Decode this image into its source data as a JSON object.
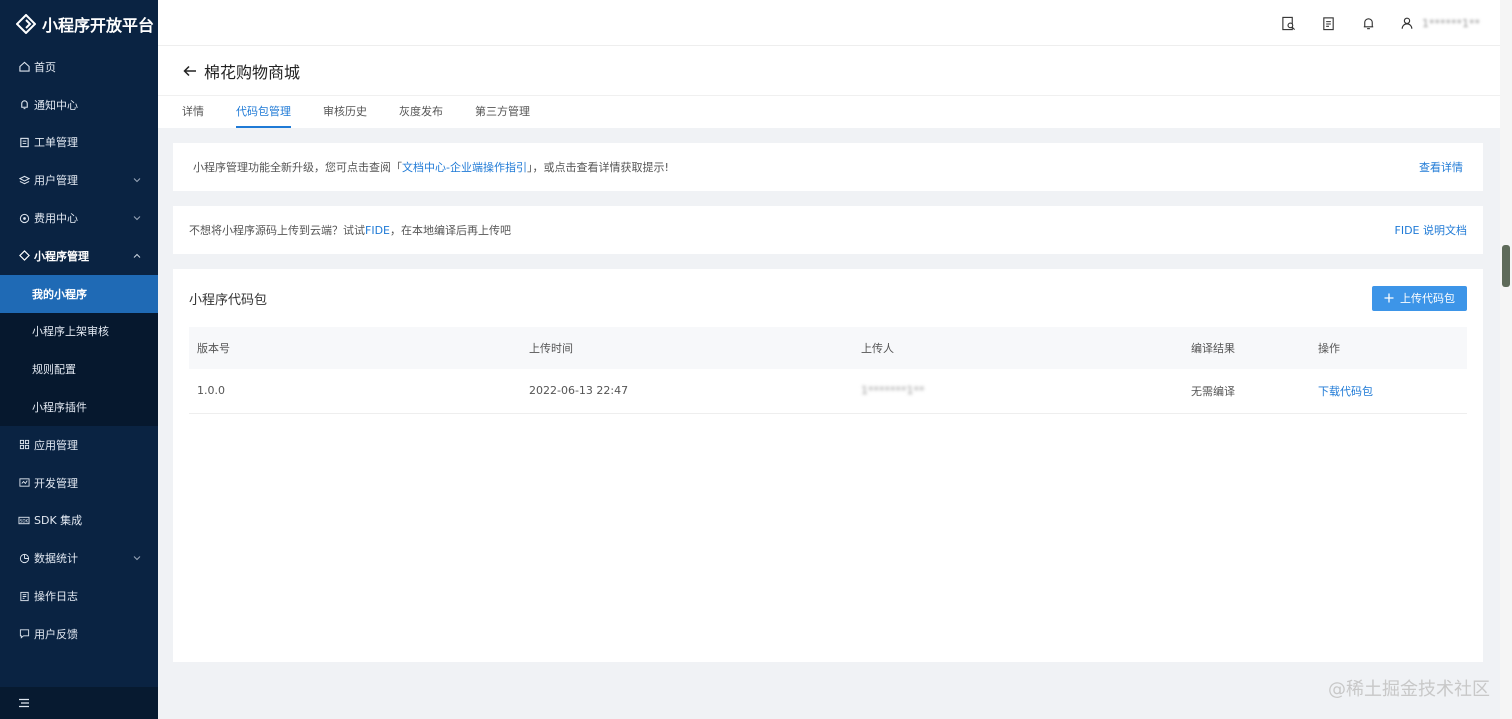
{
  "app": {
    "logo_text": "小程序开放平台"
  },
  "sidebar": {
    "items": [
      {
        "label": "首页",
        "icon": "home-icon"
      },
      {
        "label": "通知中心",
        "icon": "bell-icon"
      },
      {
        "label": "工单管理",
        "icon": "ticket-icon"
      },
      {
        "label": "用户管理",
        "icon": "users-icon"
      },
      {
        "label": "费用中心",
        "icon": "fee-icon"
      },
      {
        "label": "小程序管理",
        "icon": "miniapp-icon"
      },
      {
        "label": "应用管理",
        "icon": "grid-icon"
      },
      {
        "label": "开发管理",
        "icon": "dev-icon"
      },
      {
        "label": "SDK 集成",
        "icon": "sdk-icon"
      },
      {
        "label": "数据统计",
        "icon": "chart-icon"
      },
      {
        "label": "操作日志",
        "icon": "log-icon"
      },
      {
        "label": "用户反馈",
        "icon": "feedback-icon"
      }
    ],
    "submenu": [
      {
        "label": "我的小程序"
      },
      {
        "label": "小程序上架审核"
      },
      {
        "label": "规则配置"
      },
      {
        "label": "小程序插件"
      }
    ]
  },
  "topbar": {
    "user_name": "1******1**"
  },
  "header": {
    "title": "棉花购物商城",
    "tabs": [
      {
        "label": "详情"
      },
      {
        "label": "代码包管理"
      },
      {
        "label": "审核历史"
      },
      {
        "label": "灰度发布"
      },
      {
        "label": "第三方管理"
      }
    ]
  },
  "notice1": {
    "prefix": "小程序管理功能全新升级，您可点击查阅「",
    "link": "文档中心-企业端操作指引",
    "suffix": "」，或点击查看详情获取提示!",
    "action": "查看详情"
  },
  "notice2": {
    "prefix": "不想将小程序源码上传到云端？试试",
    "link": "FIDE",
    "suffix": "，在本地编译后再上传吧",
    "action": "FIDE 说明文档"
  },
  "main": {
    "title": "小程序代码包",
    "upload_label": "上传代码包",
    "columns": [
      "版本号",
      "上传时间",
      "上传人",
      "编译结果",
      "操作"
    ],
    "rows": [
      {
        "version": "1.0.0",
        "time": "2022-06-13 22:47",
        "uploader": "1*******1**",
        "result": "无需编译",
        "action": "下载代码包"
      }
    ]
  },
  "watermark": "@稀土掘金技术社区"
}
